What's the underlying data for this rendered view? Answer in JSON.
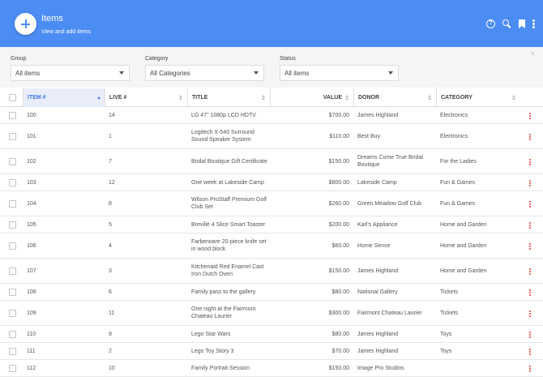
{
  "header": {
    "title": "Items",
    "subtitle": "View and add items",
    "icons": [
      "help-icon",
      "search-icon",
      "bookmark-icon",
      "more-icon"
    ]
  },
  "filters": {
    "group": {
      "label": "Group",
      "value": "All items"
    },
    "category": {
      "label": "Category",
      "value": "All Categories"
    },
    "status": {
      "label": "Status",
      "value": "All items"
    },
    "close_label": "×"
  },
  "table": {
    "columns": {
      "item": "ITEM #",
      "live": "LIVE #",
      "title": "TITLE",
      "value": "VALUE",
      "donor": "DONOR",
      "category": "CATEGORY"
    },
    "rows": [
      {
        "item": "100",
        "live": "14",
        "title": "LG 47\" 1080p LCD HDTV",
        "value": "$700.00",
        "donor": "James Highland",
        "category": "Electronics"
      },
      {
        "item": "101",
        "live": "1",
        "title": "Logitech X-540 Surround Sound Speaker System",
        "value": "$110.00",
        "donor": "Best Buy",
        "category": "Electronics"
      },
      {
        "item": "102",
        "live": "7",
        "title": "Bridal Boutique Gift Certificate",
        "value": "$150.00",
        "donor": "Dreams Come True Bridal Boutique",
        "category": "For the Ladies"
      },
      {
        "item": "103",
        "live": "12",
        "title": "One week at Lakeside Camp",
        "value": "$800.00",
        "donor": "Lakeside Camp",
        "category": "Fun & Games"
      },
      {
        "item": "104",
        "live": "8",
        "title": "Wilson ProStaff Premium Golf Club Set",
        "value": "$260.00",
        "donor": "Green Meadow Golf Club",
        "category": "Fun & Games"
      },
      {
        "item": "105",
        "live": "5",
        "title": "Breville 4 Slice Smart Toaster",
        "value": "$200.00",
        "donor": "Karl's Appliance",
        "category": "Home and Garden"
      },
      {
        "item": "106",
        "live": "4",
        "title": "Farberware 20-piece knife set in wood block",
        "value": "$60.00",
        "donor": "Home Sense",
        "category": "Home and Garden"
      },
      {
        "item": "107",
        "live": "3",
        "title": "Kitchenaid Red Enamel Cast Iron Dutch Oven",
        "value": "$150.00",
        "donor": "James Highland",
        "category": "Home and Garden"
      },
      {
        "item": "108",
        "live": "6",
        "title": "Family pass to the gallery",
        "value": "$80.00",
        "donor": "National Gallery",
        "category": "Tickets"
      },
      {
        "item": "109",
        "live": "11",
        "title": "One night at the Fairmont Chateau Laurier",
        "value": "$300.00",
        "donor": "Fairmont Chateau Laurier",
        "category": "Tickets"
      },
      {
        "item": "110",
        "live": "9",
        "title": "Lego Star Wars",
        "value": "$80.00",
        "donor": "James Highland",
        "category": "Toys"
      },
      {
        "item": "111",
        "live": "2",
        "title": "Lego Toy Story 3",
        "value": "$70.00",
        "donor": "James Highland",
        "category": "Toys"
      },
      {
        "item": "112",
        "live": "10",
        "title": "Family Portrait Session",
        "value": "$150.00",
        "donor": "Image Pro Studios",
        "category": ""
      }
    ]
  },
  "colors": {
    "header": "#4b8df3",
    "sorted_column": "#3f78e0",
    "row_menu": "#e53935"
  }
}
